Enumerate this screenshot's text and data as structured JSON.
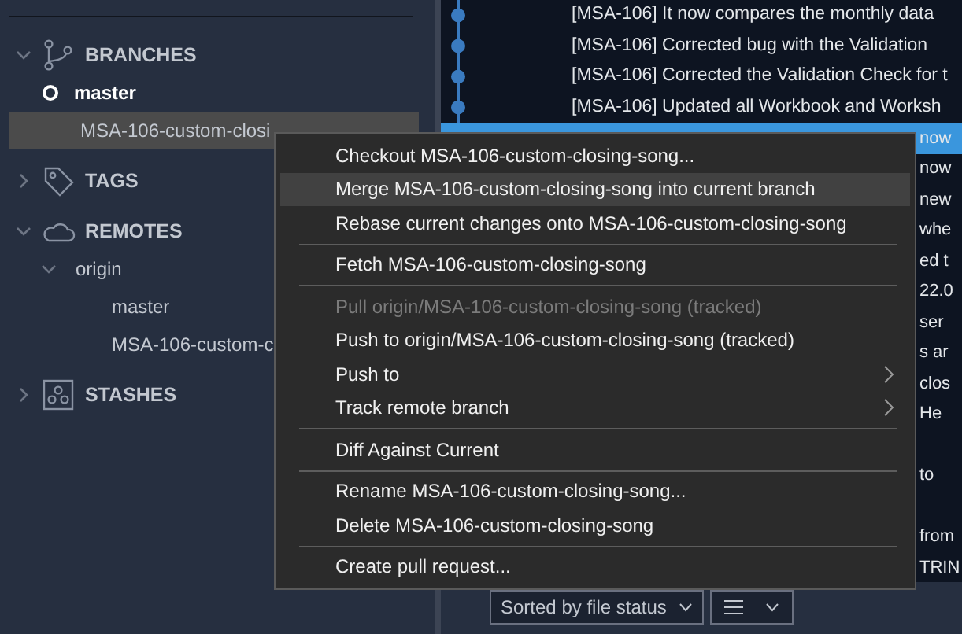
{
  "sidebar": {
    "sections": [
      {
        "title": "BRANCHES",
        "kind": "branches",
        "expanded": true,
        "items": [
          {
            "label": "master",
            "current": true,
            "selected": false
          },
          {
            "label": "MSA-106-custom-closi",
            "current": false,
            "selected": true
          }
        ]
      },
      {
        "title": "TAGS",
        "kind": "tags",
        "expanded": false
      },
      {
        "title": "REMOTES",
        "kind": "remotes",
        "expanded": true,
        "items": [
          {
            "label": "origin",
            "expanded": true,
            "selected": false,
            "children": [
              {
                "label": "master",
                "selected": false
              },
              {
                "label": "MSA-106-custom-c",
                "selected": false
              }
            ]
          }
        ]
      },
      {
        "title": "STASHES",
        "kind": "stashes",
        "expanded": false
      }
    ]
  },
  "commits": [
    {
      "kind": "message",
      "message": "[MSA-106] It now compares the monthly data",
      "selected": false
    },
    {
      "kind": "message",
      "message": "[MSA-106] Corrected bug with the Validation",
      "selected": false
    },
    {
      "kind": "message",
      "message": "[MSA-106] Corrected the Validation Check for t",
      "selected": false
    },
    {
      "kind": "message",
      "message": "[MSA-106] Updated all Workbook and Worksh",
      "selected": false
    },
    {
      "kind": "fragment",
      "message": "now",
      "selected": true
    },
    {
      "kind": "fragment",
      "message": "now",
      "selected": false
    },
    {
      "kind": "fragment",
      "message": "new",
      "selected": false
    },
    {
      "kind": "fragment",
      "message": "whe",
      "selected": false
    },
    {
      "kind": "fragment",
      "message": "ed t",
      "selected": false
    },
    {
      "kind": "fragment",
      "message": "22.0",
      "selected": false
    },
    {
      "kind": "fragment",
      "message": "ser",
      "selected": false
    },
    {
      "kind": "fragment",
      "message": "s ar",
      "selected": false
    },
    {
      "kind": "fragment",
      "message": "clos",
      "selected": false
    },
    {
      "kind": "fragment",
      "message": "He",
      "selected": false
    },
    {
      "kind": "fragment",
      "selected": false
    },
    {
      "kind": "fragment",
      "message": "to",
      "selected": false
    },
    {
      "kind": "fragment",
      "selected": false
    },
    {
      "kind": "fragment",
      "message": "from",
      "selected": false
    },
    {
      "kind": "fragment",
      "message": "TRIN",
      "selected": false
    }
  ],
  "toolbar": {
    "sort_dropdown": "Sorted by file status"
  },
  "context_menu": {
    "items": [
      {
        "kind": "item",
        "label": "Checkout MSA-106-custom-closing-song...",
        "hovered": false,
        "disabled": false,
        "submenu": false
      },
      {
        "kind": "item",
        "label": "Merge MSA-106-custom-closing-song into current branch",
        "hovered": true,
        "disabled": false,
        "submenu": false
      },
      {
        "kind": "item",
        "label": "Rebase current changes onto MSA-106-custom-closing-song",
        "hovered": false,
        "disabled": false,
        "submenu": false
      },
      {
        "kind": "separator"
      },
      {
        "kind": "item",
        "label": "Fetch MSA-106-custom-closing-song",
        "hovered": false,
        "disabled": false,
        "submenu": false
      },
      {
        "kind": "separator"
      },
      {
        "kind": "item",
        "label": "Pull origin/MSA-106-custom-closing-song (tracked)",
        "hovered": false,
        "disabled": true,
        "submenu": false
      },
      {
        "kind": "item",
        "label": "Push to origin/MSA-106-custom-closing-song (tracked)",
        "hovered": false,
        "disabled": false,
        "submenu": false
      },
      {
        "kind": "item",
        "label": "Push to",
        "hovered": false,
        "disabled": false,
        "submenu": true
      },
      {
        "kind": "item",
        "label": "Track remote branch",
        "hovered": false,
        "disabled": false,
        "submenu": true
      },
      {
        "kind": "separator"
      },
      {
        "kind": "item",
        "label": "Diff Against Current",
        "hovered": false,
        "disabled": false,
        "submenu": false
      },
      {
        "kind": "separator"
      },
      {
        "kind": "item",
        "label": "Rename MSA-106-custom-closing-song...",
        "hovered": false,
        "disabled": false,
        "submenu": false
      },
      {
        "kind": "item",
        "label": "Delete MSA-106-custom-closing-song",
        "hovered": false,
        "disabled": false,
        "submenu": false
      },
      {
        "kind": "separator"
      },
      {
        "kind": "item",
        "label": "Create pull request...",
        "hovered": false,
        "disabled": false,
        "submenu": false
      }
    ]
  }
}
